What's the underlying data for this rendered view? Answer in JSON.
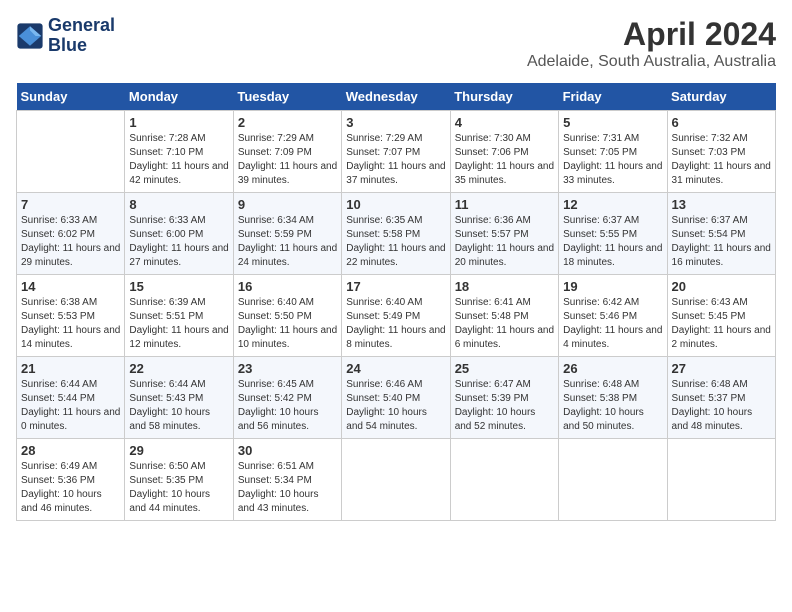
{
  "header": {
    "logo_line1": "General",
    "logo_line2": "Blue",
    "title": "April 2024",
    "subtitle": "Adelaide, South Australia, Australia"
  },
  "weekdays": [
    "Sunday",
    "Monday",
    "Tuesday",
    "Wednesday",
    "Thursday",
    "Friday",
    "Saturday"
  ],
  "weeks": [
    [
      {
        "day": "",
        "sunrise": "",
        "sunset": "",
        "daylight": ""
      },
      {
        "day": "1",
        "sunrise": "Sunrise: 7:28 AM",
        "sunset": "Sunset: 7:10 PM",
        "daylight": "Daylight: 11 hours and 42 minutes."
      },
      {
        "day": "2",
        "sunrise": "Sunrise: 7:29 AM",
        "sunset": "Sunset: 7:09 PM",
        "daylight": "Daylight: 11 hours and 39 minutes."
      },
      {
        "day": "3",
        "sunrise": "Sunrise: 7:29 AM",
        "sunset": "Sunset: 7:07 PM",
        "daylight": "Daylight: 11 hours and 37 minutes."
      },
      {
        "day": "4",
        "sunrise": "Sunrise: 7:30 AM",
        "sunset": "Sunset: 7:06 PM",
        "daylight": "Daylight: 11 hours and 35 minutes."
      },
      {
        "day": "5",
        "sunrise": "Sunrise: 7:31 AM",
        "sunset": "Sunset: 7:05 PM",
        "daylight": "Daylight: 11 hours and 33 minutes."
      },
      {
        "day": "6",
        "sunrise": "Sunrise: 7:32 AM",
        "sunset": "Sunset: 7:03 PM",
        "daylight": "Daylight: 11 hours and 31 minutes."
      }
    ],
    [
      {
        "day": "7",
        "sunrise": "Sunrise: 6:33 AM",
        "sunset": "Sunset: 6:02 PM",
        "daylight": "Daylight: 11 hours and 29 minutes."
      },
      {
        "day": "8",
        "sunrise": "Sunrise: 6:33 AM",
        "sunset": "Sunset: 6:00 PM",
        "daylight": "Daylight: 11 hours and 27 minutes."
      },
      {
        "day": "9",
        "sunrise": "Sunrise: 6:34 AM",
        "sunset": "Sunset: 5:59 PM",
        "daylight": "Daylight: 11 hours and 24 minutes."
      },
      {
        "day": "10",
        "sunrise": "Sunrise: 6:35 AM",
        "sunset": "Sunset: 5:58 PM",
        "daylight": "Daylight: 11 hours and 22 minutes."
      },
      {
        "day": "11",
        "sunrise": "Sunrise: 6:36 AM",
        "sunset": "Sunset: 5:57 PM",
        "daylight": "Daylight: 11 hours and 20 minutes."
      },
      {
        "day": "12",
        "sunrise": "Sunrise: 6:37 AM",
        "sunset": "Sunset: 5:55 PM",
        "daylight": "Daylight: 11 hours and 18 minutes."
      },
      {
        "day": "13",
        "sunrise": "Sunrise: 6:37 AM",
        "sunset": "Sunset: 5:54 PM",
        "daylight": "Daylight: 11 hours and 16 minutes."
      }
    ],
    [
      {
        "day": "14",
        "sunrise": "Sunrise: 6:38 AM",
        "sunset": "Sunset: 5:53 PM",
        "daylight": "Daylight: 11 hours and 14 minutes."
      },
      {
        "day": "15",
        "sunrise": "Sunrise: 6:39 AM",
        "sunset": "Sunset: 5:51 PM",
        "daylight": "Daylight: 11 hours and 12 minutes."
      },
      {
        "day": "16",
        "sunrise": "Sunrise: 6:40 AM",
        "sunset": "Sunset: 5:50 PM",
        "daylight": "Daylight: 11 hours and 10 minutes."
      },
      {
        "day": "17",
        "sunrise": "Sunrise: 6:40 AM",
        "sunset": "Sunset: 5:49 PM",
        "daylight": "Daylight: 11 hours and 8 minutes."
      },
      {
        "day": "18",
        "sunrise": "Sunrise: 6:41 AM",
        "sunset": "Sunset: 5:48 PM",
        "daylight": "Daylight: 11 hours and 6 minutes."
      },
      {
        "day": "19",
        "sunrise": "Sunrise: 6:42 AM",
        "sunset": "Sunset: 5:46 PM",
        "daylight": "Daylight: 11 hours and 4 minutes."
      },
      {
        "day": "20",
        "sunrise": "Sunrise: 6:43 AM",
        "sunset": "Sunset: 5:45 PM",
        "daylight": "Daylight: 11 hours and 2 minutes."
      }
    ],
    [
      {
        "day": "21",
        "sunrise": "Sunrise: 6:44 AM",
        "sunset": "Sunset: 5:44 PM",
        "daylight": "Daylight: 11 hours and 0 minutes."
      },
      {
        "day": "22",
        "sunrise": "Sunrise: 6:44 AM",
        "sunset": "Sunset: 5:43 PM",
        "daylight": "Daylight: 10 hours and 58 minutes."
      },
      {
        "day": "23",
        "sunrise": "Sunrise: 6:45 AM",
        "sunset": "Sunset: 5:42 PM",
        "daylight": "Daylight: 10 hours and 56 minutes."
      },
      {
        "day": "24",
        "sunrise": "Sunrise: 6:46 AM",
        "sunset": "Sunset: 5:40 PM",
        "daylight": "Daylight: 10 hours and 54 minutes."
      },
      {
        "day": "25",
        "sunrise": "Sunrise: 6:47 AM",
        "sunset": "Sunset: 5:39 PM",
        "daylight": "Daylight: 10 hours and 52 minutes."
      },
      {
        "day": "26",
        "sunrise": "Sunrise: 6:48 AM",
        "sunset": "Sunset: 5:38 PM",
        "daylight": "Daylight: 10 hours and 50 minutes."
      },
      {
        "day": "27",
        "sunrise": "Sunrise: 6:48 AM",
        "sunset": "Sunset: 5:37 PM",
        "daylight": "Daylight: 10 hours and 48 minutes."
      }
    ],
    [
      {
        "day": "28",
        "sunrise": "Sunrise: 6:49 AM",
        "sunset": "Sunset: 5:36 PM",
        "daylight": "Daylight: 10 hours and 46 minutes."
      },
      {
        "day": "29",
        "sunrise": "Sunrise: 6:50 AM",
        "sunset": "Sunset: 5:35 PM",
        "daylight": "Daylight: 10 hours and 44 minutes."
      },
      {
        "day": "30",
        "sunrise": "Sunrise: 6:51 AM",
        "sunset": "Sunset: 5:34 PM",
        "daylight": "Daylight: 10 hours and 43 minutes."
      },
      {
        "day": "",
        "sunrise": "",
        "sunset": "",
        "daylight": ""
      },
      {
        "day": "",
        "sunrise": "",
        "sunset": "",
        "daylight": ""
      },
      {
        "day": "",
        "sunrise": "",
        "sunset": "",
        "daylight": ""
      },
      {
        "day": "",
        "sunrise": "",
        "sunset": "",
        "daylight": ""
      }
    ]
  ]
}
